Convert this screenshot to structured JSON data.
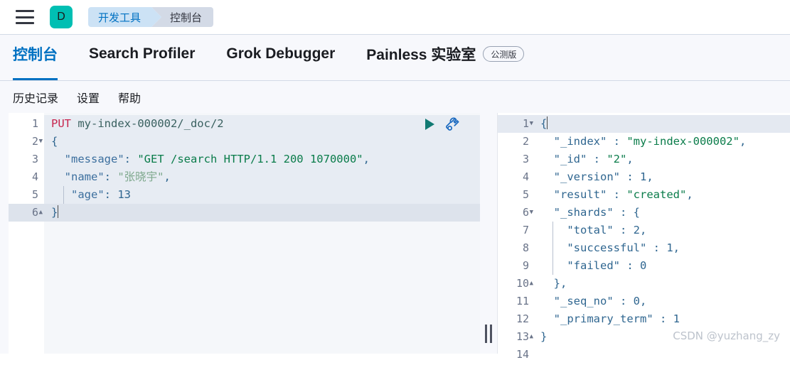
{
  "header": {
    "menu_icon": "hamburger-menu-icon",
    "avatar_letter": "D",
    "avatar_color": "#00BFB3",
    "breadcrumbs": [
      {
        "label": "开发工具",
        "color": "#0071C2",
        "bg": "#CCE2F5"
      },
      {
        "label": "控制台",
        "color": "#343741",
        "bg": "#D3DAE6"
      }
    ]
  },
  "tabs": [
    {
      "label": "控制台",
      "active": true,
      "badge": null
    },
    {
      "label": "Search Profiler",
      "active": false,
      "badge": null
    },
    {
      "label": "Grok Debugger",
      "active": false,
      "badge": null
    },
    {
      "label": "Painless 实验室",
      "active": false,
      "badge": "公测版"
    }
  ],
  "submenu": [
    {
      "label": "历史记录"
    },
    {
      "label": "设置"
    },
    {
      "label": "帮助"
    }
  ],
  "editor": {
    "play_icon": "play-triangle-icon",
    "wrench_icon": "wrench-icon",
    "accent_color": "#0071C2",
    "line_numbers": [
      "1",
      "2",
      "3",
      "4",
      "5",
      "6"
    ],
    "fold_markers": {
      "2": "▾",
      "6": "▴"
    },
    "current_line": 6,
    "lines": [
      {
        "n": 1,
        "method": "PUT",
        "url": " my-index-000002/_doc/2"
      },
      {
        "n": 2,
        "text": "{"
      },
      {
        "n": 3,
        "key": "\"message\"",
        "sep": ": ",
        "value": "\"GET /search HTTP/1.1 200 1070000\"",
        "comma": ","
      },
      {
        "n": 4,
        "key": "\"name\"",
        "sep": ": ",
        "value": "\"张晓宇\"",
        "comma": ","
      },
      {
        "n": 5,
        "key": "\"age\"",
        "sep": ": ",
        "value": "13",
        "comma": ""
      },
      {
        "n": 6,
        "text": "}"
      }
    ]
  },
  "response": {
    "line_numbers": [
      "1",
      "2",
      "3",
      "4",
      "5",
      "6",
      "7",
      "8",
      "9",
      "10",
      "11",
      "12",
      "13",
      "14"
    ],
    "fold_markers": {
      "1": "▾",
      "6": "▾",
      "10": "▴",
      "13": "▴"
    },
    "current_line": 1,
    "lines": [
      {
        "n": 1,
        "text": "{"
      },
      {
        "n": 2,
        "key": "\"_index\"",
        "sep": " : ",
        "value": "\"my-index-000002\"",
        "comma": ","
      },
      {
        "n": 3,
        "key": "\"_id\"",
        "sep": " : ",
        "value": "\"2\"",
        "comma": ","
      },
      {
        "n": 4,
        "key": "\"_version\"",
        "sep": " : ",
        "value": "1",
        "comma": ","
      },
      {
        "n": 5,
        "key": "\"result\"",
        "sep": " : ",
        "value": "\"created\"",
        "comma": ","
      },
      {
        "n": 6,
        "key": "\"_shards\"",
        "sep": " : ",
        "value": "{",
        "comma": ""
      },
      {
        "n": 7,
        "key": "\"total\"",
        "sep": " : ",
        "value": "2",
        "comma": ","
      },
      {
        "n": 8,
        "key": "\"successful\"",
        "sep": " : ",
        "value": "1",
        "comma": ","
      },
      {
        "n": 9,
        "key": "\"failed\"",
        "sep": " : ",
        "value": "0",
        "comma": ""
      },
      {
        "n": 10,
        "text": "},"
      },
      {
        "n": 11,
        "key": "\"_seq_no\"",
        "sep": " : ",
        "value": "0",
        "comma": ","
      },
      {
        "n": 12,
        "key": "\"_primary_term\"",
        "sep": " : ",
        "value": "1",
        "comma": ""
      },
      {
        "n": 13,
        "text": "}"
      },
      {
        "n": 14,
        "text": ""
      }
    ]
  },
  "splitter": {
    "handle_icon": "drag-handle-icon"
  },
  "watermark": {
    "text": "CSDN @yuzhang_zy"
  }
}
